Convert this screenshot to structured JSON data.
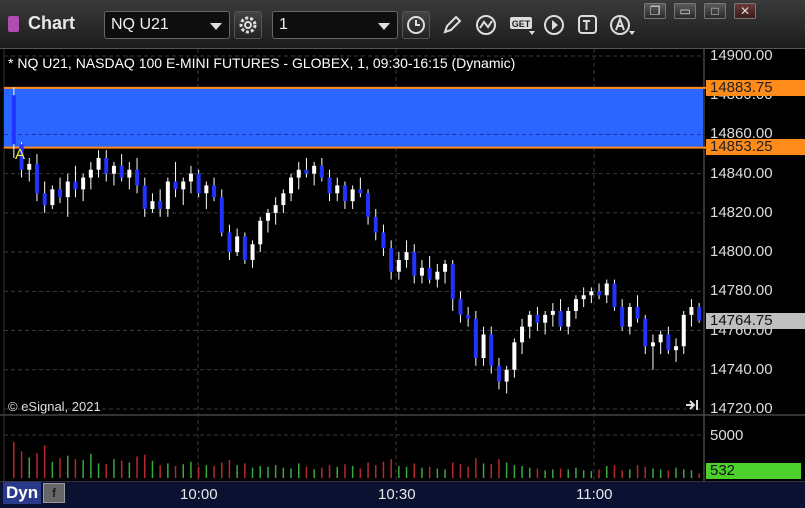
{
  "window": {
    "title": "Chart",
    "symbol": "NQ U21",
    "interval": "1",
    "buttons": {
      "minimize": "❐",
      "restore": "▭",
      "maximize": "□",
      "close": "✕"
    }
  },
  "chart": {
    "header": "* NQ U21, NASDAQ 100 E-MINI FUTURES - GLOBEX, 1, 09:30-16:15 (Dynamic)",
    "copyright": "© eSignal, 2021",
    "price_axis": [
      "14900.00",
      "14880.00",
      "14860.00",
      "14840.00",
      "14820.00",
      "14800.00",
      "14780.00",
      "14760.00",
      "14740.00",
      "14720.00"
    ],
    "volume_axis": [
      "5000"
    ],
    "time_axis": [
      "10:00",
      "10:30",
      "11:00"
    ],
    "annotation_label": "A",
    "zone_upper": "14883.75",
    "zone_lower": "14853.25",
    "last_price": "14764.75",
    "last_volume": "532",
    "mode_button": "Dyn",
    "colors": {
      "background": "#000000",
      "zone_fill": "#2a66ff",
      "zone_border": "#ff8c1a",
      "up_candle": "#ffffff",
      "down_candle": "#2233ff",
      "volume_up": "#3aa83a",
      "volume_down": "#b52a2a",
      "grid": "#3a3a3a",
      "last_price_tag": "#bfbfbf",
      "volume_tag": "#4cd02c"
    }
  },
  "chart_data": {
    "type": "candlestick",
    "y_range": [
      14720,
      14905
    ],
    "x_labels": [
      "10:00",
      "10:30",
      "11:00"
    ],
    "candles": [
      [
        14880,
        14884,
        14848,
        14855
      ],
      [
        14855,
        14856,
        14838,
        14842
      ],
      [
        14842,
        14848,
        14836,
        14845
      ],
      [
        14845,
        14850,
        14826,
        14830
      ],
      [
        14830,
        14836,
        14820,
        14824
      ],
      [
        14824,
        14834,
        14822,
        14832
      ],
      [
        14832,
        14838,
        14825,
        14828
      ],
      [
        14828,
        14840,
        14818,
        14836
      ],
      [
        14836,
        14844,
        14828,
        14832
      ],
      [
        14832,
        14840,
        14826,
        14838
      ],
      [
        14838,
        14846,
        14832,
        14842
      ],
      [
        14842,
        14852,
        14838,
        14848
      ],
      [
        14848,
        14852,
        14836,
        14840
      ],
      [
        14840,
        14846,
        14834,
        14844
      ],
      [
        14844,
        14850,
        14836,
        14838
      ],
      [
        14838,
        14846,
        14832,
        14842
      ],
      [
        14842,
        14848,
        14830,
        14834
      ],
      [
        14834,
        14838,
        14818,
        14822
      ],
      [
        14822,
        14830,
        14820,
        14826
      ],
      [
        14826,
        14832,
        14818,
        14822
      ],
      [
        14822,
        14838,
        14818,
        14836
      ],
      [
        14836,
        14846,
        14828,
        14832
      ],
      [
        14832,
        14838,
        14824,
        14836
      ],
      [
        14836,
        14844,
        14830,
        14840
      ],
      [
        14840,
        14842,
        14828,
        14830
      ],
      [
        14830,
        14836,
        14822,
        14834
      ],
      [
        14834,
        14838,
        14826,
        14828
      ],
      [
        14828,
        14832,
        14808,
        14810
      ],
      [
        14810,
        14814,
        14796,
        14800
      ],
      [
        14800,
        14812,
        14798,
        14808
      ],
      [
        14808,
        14810,
        14794,
        14796
      ],
      [
        14796,
        14806,
        14792,
        14804
      ],
      [
        14804,
        14818,
        14800,
        14816
      ],
      [
        14816,
        14822,
        14810,
        14820
      ],
      [
        14820,
        14828,
        14814,
        14824
      ],
      [
        14824,
        14832,
        14820,
        14830
      ],
      [
        14830,
        14840,
        14826,
        14838
      ],
      [
        14838,
        14846,
        14832,
        14842
      ],
      [
        14842,
        14848,
        14838,
        14840
      ],
      [
        14840,
        14846,
        14834,
        14844
      ],
      [
        14844,
        14848,
        14836,
        14838
      ],
      [
        14838,
        14842,
        14826,
        14830
      ],
      [
        14830,
        14838,
        14826,
        14834
      ],
      [
        14834,
        14836,
        14822,
        14826
      ],
      [
        14826,
        14834,
        14822,
        14832
      ],
      [
        14832,
        14838,
        14828,
        14830
      ],
      [
        14830,
        14832,
        14814,
        14818
      ],
      [
        14818,
        14822,
        14806,
        14810
      ],
      [
        14810,
        14814,
        14798,
        14802
      ],
      [
        14802,
        14806,
        14786,
        14790
      ],
      [
        14790,
        14800,
        14786,
        14796
      ],
      [
        14796,
        14806,
        14792,
        14800
      ],
      [
        14800,
        14804,
        14784,
        14788
      ],
      [
        14788,
        14796,
        14784,
        14792
      ],
      [
        14792,
        14798,
        14784,
        14786
      ],
      [
        14786,
        14794,
        14782,
        14790
      ],
      [
        14790,
        14796,
        14784,
        14794
      ],
      [
        14794,
        14796,
        14770,
        14776
      ],
      [
        14776,
        14780,
        14764,
        14768
      ],
      [
        14768,
        14772,
        14762,
        14766
      ],
      [
        14766,
        14770,
        14742,
        14746
      ],
      [
        14746,
        14762,
        14742,
        14758
      ],
      [
        14758,
        14762,
        14738,
        14742
      ],
      [
        14742,
        14746,
        14730,
        14734
      ],
      [
        14734,
        14742,
        14728,
        14740
      ],
      [
        14740,
        14756,
        14736,
        14754
      ],
      [
        14754,
        14766,
        14748,
        14762
      ],
      [
        14762,
        14770,
        14756,
        14768
      ],
      [
        14768,
        14772,
        14760,
        14764
      ],
      [
        14764,
        14770,
        14758,
        14768
      ],
      [
        14768,
        14774,
        14762,
        14770
      ],
      [
        14770,
        14776,
        14760,
        14762
      ],
      [
        14762,
        14772,
        14758,
        14770
      ],
      [
        14770,
        14778,
        14766,
        14776
      ],
      [
        14776,
        14782,
        14772,
        14778
      ],
      [
        14778,
        14782,
        14774,
        14780
      ],
      [
        14780,
        14784,
        14776,
        14778
      ],
      [
        14778,
        14786,
        14774,
        14784
      ],
      [
        14784,
        14786,
        14770,
        14772
      ],
      [
        14772,
        14776,
        14760,
        14762
      ],
      [
        14762,
        14774,
        14758,
        14772
      ],
      [
        14772,
        14778,
        14764,
        14766
      ],
      [
        14766,
        14768,
        14748,
        14752
      ],
      [
        14752,
        14758,
        14740,
        14754
      ],
      [
        14754,
        14760,
        14748,
        14758
      ],
      [
        14758,
        14762,
        14748,
        14750
      ],
      [
        14750,
        14756,
        14744,
        14752
      ],
      [
        14752,
        14770,
        14748,
        14768
      ],
      [
        14768,
        14776,
        14762,
        14772
      ],
      [
        14772,
        14774,
        14764,
        14765
      ]
    ],
    "volume": [
      4200,
      3100,
      2400,
      2900,
      3800,
      1900,
      2300,
      2600,
      2200,
      2100,
      2800,
      1700,
      1600,
      2200,
      2000,
      1800,
      2500,
      2700,
      2000,
      1500,
      1700,
      1400,
      1600,
      1900,
      1300,
      1500,
      1400,
      1800,
      2100,
      1500,
      1700,
      1200,
      1400,
      1300,
      1500,
      1200,
      1100,
      1700,
      1300,
      1000,
      1200,
      1500,
      1300,
      1600,
      1400,
      1100,
      1800,
      1500,
      1900,
      2200,
      1400,
      1300,
      1700,
      1200,
      1300,
      1100,
      1000,
      1800,
      1600,
      1300,
      2300,
      1700,
      1600,
      2200,
      1800,
      1500,
      1400,
      1200,
      1100,
      900,
      1000,
      1100,
      1000,
      1200,
      900,
      800,
      1000,
      1400,
      1500,
      900,
      1000,
      1500,
      1300,
      1100,
      1000,
      900,
      1200,
      1000,
      900,
      532
    ],
    "zone": {
      "upper": 14883.75,
      "lower": 14853.25
    },
    "last_price": 14764.75,
    "volume_axis_value": 5000
  }
}
